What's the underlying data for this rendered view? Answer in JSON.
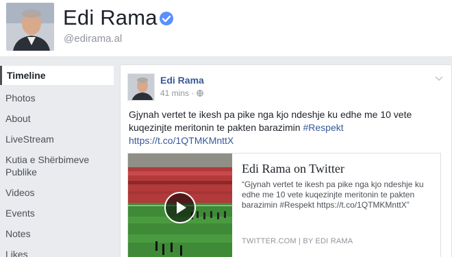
{
  "header": {
    "page_name": "Edi Rama",
    "handle": "@edirama.al"
  },
  "sidebar": {
    "items": [
      {
        "label": "Timeline",
        "active": true
      },
      {
        "label": "Photos"
      },
      {
        "label": "About"
      },
      {
        "label": "LiveStream"
      },
      {
        "label": "Kutia e Shërbimeve Publike"
      },
      {
        "label": "Videos"
      },
      {
        "label": "Events"
      },
      {
        "label": "Notes"
      },
      {
        "label": "Likes"
      }
    ]
  },
  "post": {
    "author": "Edi Rama",
    "time": "41 mins",
    "visibility_icon": "globe-icon",
    "text_before_hashtag": "Gjynah vertet te ikesh pa pike nga kjo ndeshje ku edhe me 10 vete kuqezinjte meritonin te pakten barazimin ",
    "hashtag": "#Respekt",
    "link": "https://t.co/1QTMKMnttX",
    "preview": {
      "title": "Edi Rama on Twitter",
      "description": "“Gjynah vertet te ikesh pa pike nga kjo ndeshje ku edhe me 10 vete kuqezinjte meritonin te pakten barazimin #Respekt https://t.co/1QTMKMnttX”",
      "source": "TWITTER.COM | BY EDI RAMA"
    }
  },
  "colors": {
    "link_blue": "#365899",
    "verified_blue": "#5890ff",
    "page_bg": "#e9ebee"
  }
}
